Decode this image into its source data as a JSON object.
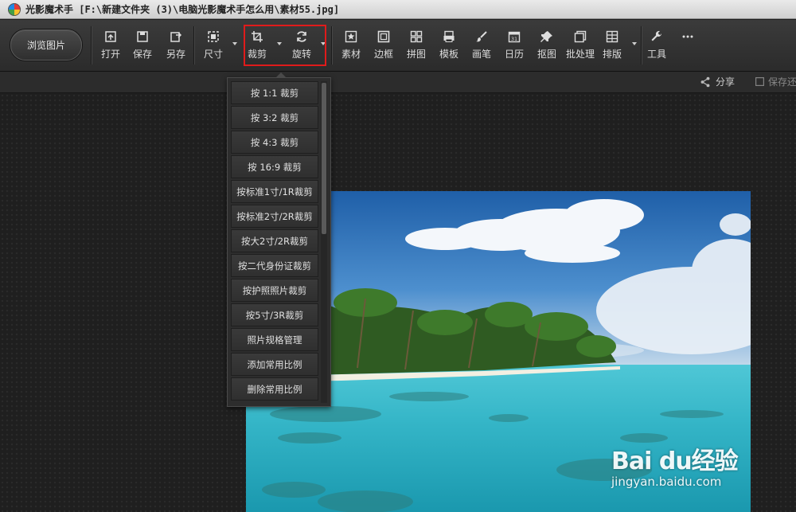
{
  "window": {
    "title": "光影魔术手 [F:\\新建文件夹 (3)\\电脑光影魔术手怎么用\\素材55.jpg]"
  },
  "toolbar": {
    "browse_label": "浏览图片",
    "buttons": [
      {
        "label": "打开",
        "icon": "open-icon"
      },
      {
        "label": "保存",
        "icon": "save-icon"
      },
      {
        "label": "另存",
        "icon": "save-as-icon"
      },
      {
        "label": "尺寸",
        "icon": "resize-icon"
      },
      {
        "label": "裁剪",
        "icon": "crop-icon"
      },
      {
        "label": "旋转",
        "icon": "rotate-icon"
      },
      {
        "label": "素材",
        "icon": "star-icon"
      },
      {
        "label": "边框",
        "icon": "frame-icon"
      },
      {
        "label": "拼图",
        "icon": "grid-icon"
      },
      {
        "label": "模板",
        "icon": "template-icon"
      },
      {
        "label": "画笔",
        "icon": "brush-icon"
      },
      {
        "label": "日历",
        "icon": "calendar-icon"
      },
      {
        "label": "抠图",
        "icon": "pin-icon"
      },
      {
        "label": "批处理",
        "icon": "batch-icon"
      },
      {
        "label": "排版",
        "icon": "layout-icon"
      },
      {
        "label": "工具",
        "icon": "wrench-icon"
      },
      {
        "label": "",
        "icon": "more-icon"
      }
    ],
    "calendar_day": "31",
    "highlight_color": "#e01b1b"
  },
  "subbar": {
    "share_label": "分享",
    "saveas_label": "保存还"
  },
  "crop_menu": {
    "items": [
      "按 1:1 裁剪",
      "按 3:2 裁剪",
      "按 4:3 裁剪",
      "按 16:9 裁剪",
      "按标准1寸/1R裁剪",
      "按标准2寸/2R裁剪",
      "按大2寸/2R裁剪",
      "按二代身份证裁剪",
      "按护照照片裁剪",
      "按5寸/3R裁剪",
      "照片规格管理",
      "添加常用比例",
      "删除常用比例"
    ]
  },
  "watermark": {
    "logo": "Bai du经验",
    "url": "jingyan.baidu.com"
  }
}
